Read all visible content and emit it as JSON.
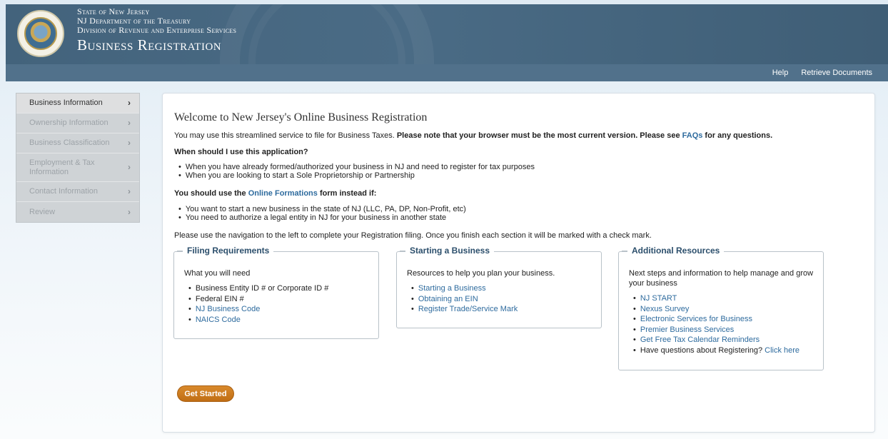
{
  "header": {
    "line1": "State of New Jersey",
    "line2": "NJ Department of the Treasury",
    "line3": "Division of Revenue and Enterprise Services",
    "title": "Business Registration"
  },
  "topnav": {
    "help": "Help",
    "retrieve": "Retrieve Documents"
  },
  "sidebar": {
    "items": [
      {
        "label": "Business Information",
        "active": true
      },
      {
        "label": "Ownership Information",
        "active": false
      },
      {
        "label": "Business Classification",
        "active": false
      },
      {
        "label": "Employment & Tax Information",
        "active": false
      },
      {
        "label": "Contact Information",
        "active": false
      },
      {
        "label": "Review",
        "active": false
      }
    ]
  },
  "main": {
    "welcome": "Welcome to New Jersey's Online Business Registration",
    "intro_plain": "You may use this streamlined service to file for Business Taxes. ",
    "intro_bold": "Please note that your browser must be the most current version. Please see ",
    "intro_link": "FAQs",
    "intro_bold_end": " for any questions.",
    "when_heading": "When should I use this application?",
    "when_items": [
      "When you have already formed/authorized your business in NJ and need to register for tax purposes",
      "When you are looking to start a Sole Proprietorship or Partnership"
    ],
    "instead_prefix": "You should use the ",
    "instead_link": "Online Formations",
    "instead_suffix": " form instead if:",
    "instead_items": [
      "You want to start a new business in the state of NJ (LLC, PA, DP, Non-Profit, etc)",
      "You need to authorize a legal entity in NJ for your business in another state"
    ],
    "nav_note": "Please use the navigation to the left to complete your Registration filing. Once you finish each section it will be marked with a check mark.",
    "filing": {
      "title": "Filing Requirements",
      "intro": "What you will need",
      "items": [
        "Business Entity ID # or Corporate ID #",
        "Federal EIN #"
      ],
      "links": [
        "NJ Business Code",
        "NAICS Code"
      ]
    },
    "starting": {
      "title": "Starting a Business",
      "intro": "Resources to help you plan your business.",
      "links": [
        "Starting a Business",
        "Obtaining an EIN",
        "Register Trade/Service Mark"
      ]
    },
    "resources": {
      "title": "Additional Resources",
      "intro": "Next steps and information to help manage and grow your business",
      "links": [
        "NJ START",
        "Nexus Survey",
        "Electronic Services for Business",
        "Premier Business Services",
        "Get Free Tax Calendar Reminders"
      ],
      "question": "Have questions about Registering? ",
      "question_link": "Click here"
    },
    "get_started": "Get Started"
  }
}
